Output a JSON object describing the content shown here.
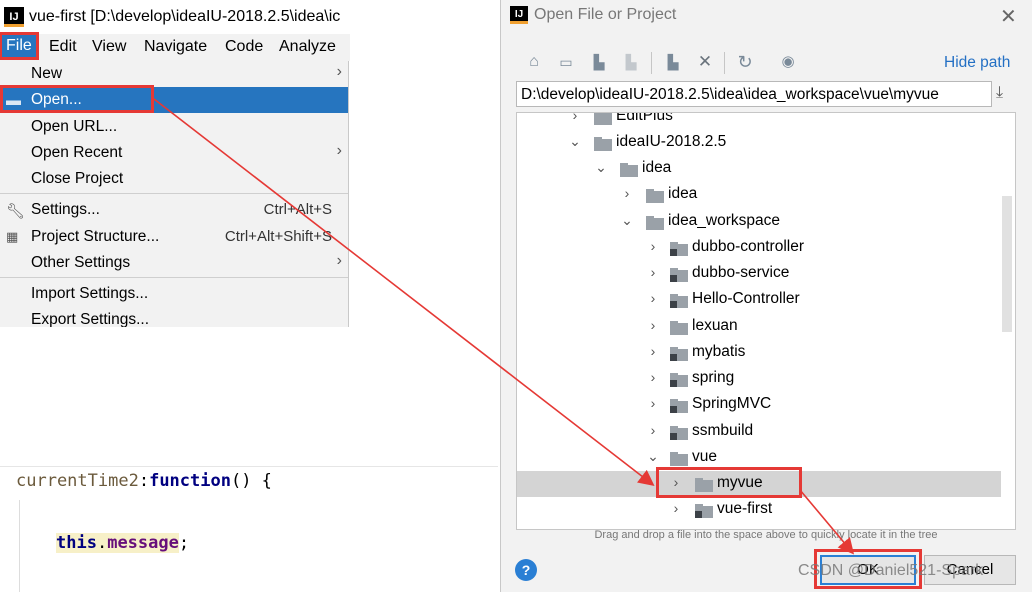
{
  "ide": {
    "window_title": "vue-first [D:\\develop\\ideaIU-2018.2.5\\idea\\ic",
    "logo_text": "IJ",
    "menubar": [
      {
        "label": "File"
      },
      {
        "label": "Edit"
      },
      {
        "label": "View"
      },
      {
        "label": "Navigate"
      },
      {
        "label": "Code"
      },
      {
        "label": "Analyze"
      }
    ],
    "file_menu": {
      "new": "New",
      "open": "Open...",
      "open_url": "Open URL...",
      "open_recent": "Open Recent",
      "close_project": "Close Project",
      "settings": "Settings...",
      "settings_shortcut": "Ctrl+Alt+S",
      "project_structure": "Project Structure...",
      "project_structure_shortcut": "Ctrl+Alt+Shift+S",
      "other_settings": "Other Settings",
      "import_settings": "Import Settings...",
      "export_settings": "Export Settings..."
    },
    "editor": {
      "fn_name": "currentTime2",
      "colon": ":",
      "keyword": "function",
      "paren_brace": "() {",
      "this_kw": "this",
      "dot": ".",
      "prop": "message",
      "semicolon": ";"
    }
  },
  "dialog": {
    "title": "Open File or Project",
    "logo_text": "IJ",
    "close_glyph": "✕",
    "hide_path": "Hide path",
    "path_value": "D:\\develop\\ideaIU-2018.2.5\\idea\\idea_workspace\\vue\\myvue",
    "tree": {
      "editplus": "EditPlus",
      "ideaiu": "ideaIU-2018.2.5",
      "idea_parent": "idea",
      "idea_child": "idea",
      "idea_workspace": "idea_workspace",
      "dubbo_controller": "dubbo-controller",
      "dubbo_service": "dubbo-service",
      "hello_controller": "Hello-Controller",
      "lexuan": "lexuan",
      "mybatis": "mybatis",
      "spring": "spring",
      "springmvc": "SpringMVC",
      "ssmbuild": "ssmbuild",
      "vue": "vue",
      "myvue": "myvue",
      "vue_first": "vue-first"
    },
    "hint": "Drag and drop a file into the space above to quickly locate it in the tree",
    "help_glyph": "?",
    "ok_label": "OK",
    "cancel_label": "Cancel"
  },
  "watermark": "CSDN @Daniel521-Spark",
  "colors": {
    "selection_blue": "#2675bf",
    "annotation_red": "#e53935",
    "link_blue": "#2470c4"
  },
  "icons": {
    "home": "home-icon",
    "desktop": "desktop-icon",
    "project_folder": "project-folder-icon",
    "module_folder": "module-folder-icon",
    "new_folder": "new-folder-icon",
    "delete": "delete-icon",
    "refresh": "refresh-icon",
    "show_hidden": "show-hidden-icon",
    "download": "download-icon",
    "wrench": "wrench-icon",
    "structure": "project-structure-icon"
  }
}
